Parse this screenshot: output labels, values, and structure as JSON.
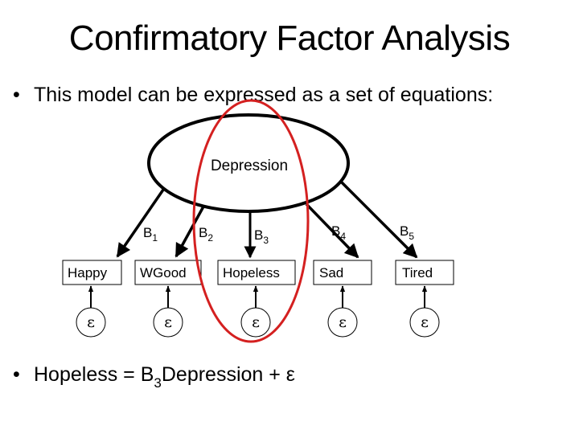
{
  "slide": {
    "title": "Confirmatory Factor Analysis",
    "bullets": [
      {
        "symbol": "•",
        "text": "This model can be expressed as a set of equations:"
      },
      {
        "symbol": "•",
        "lhs": "Hopeless = B",
        "subscript": "3",
        "rhs": "Depression + ε"
      }
    ]
  },
  "diagram": {
    "latent_factor": {
      "label": "Depression"
    },
    "indicators": [
      {
        "label": "Happy",
        "loading": "B",
        "loading_sub": "1",
        "error": "ε"
      },
      {
        "label": "WGood",
        "loading": "B",
        "loading_sub": "2",
        "error": "ε"
      },
      {
        "label": "Hopeless",
        "loading": "B",
        "loading_sub": "3",
        "error": "ε",
        "highlighted": true
      },
      {
        "label": "Sad",
        "loading": "B",
        "loading_sub": "4",
        "error": "ε"
      },
      {
        "label": "Tired",
        "loading": "B",
        "loading_sub": "5",
        "error": "ε"
      }
    ],
    "highlight_color": "#d42020",
    "line_color": "#000000"
  }
}
